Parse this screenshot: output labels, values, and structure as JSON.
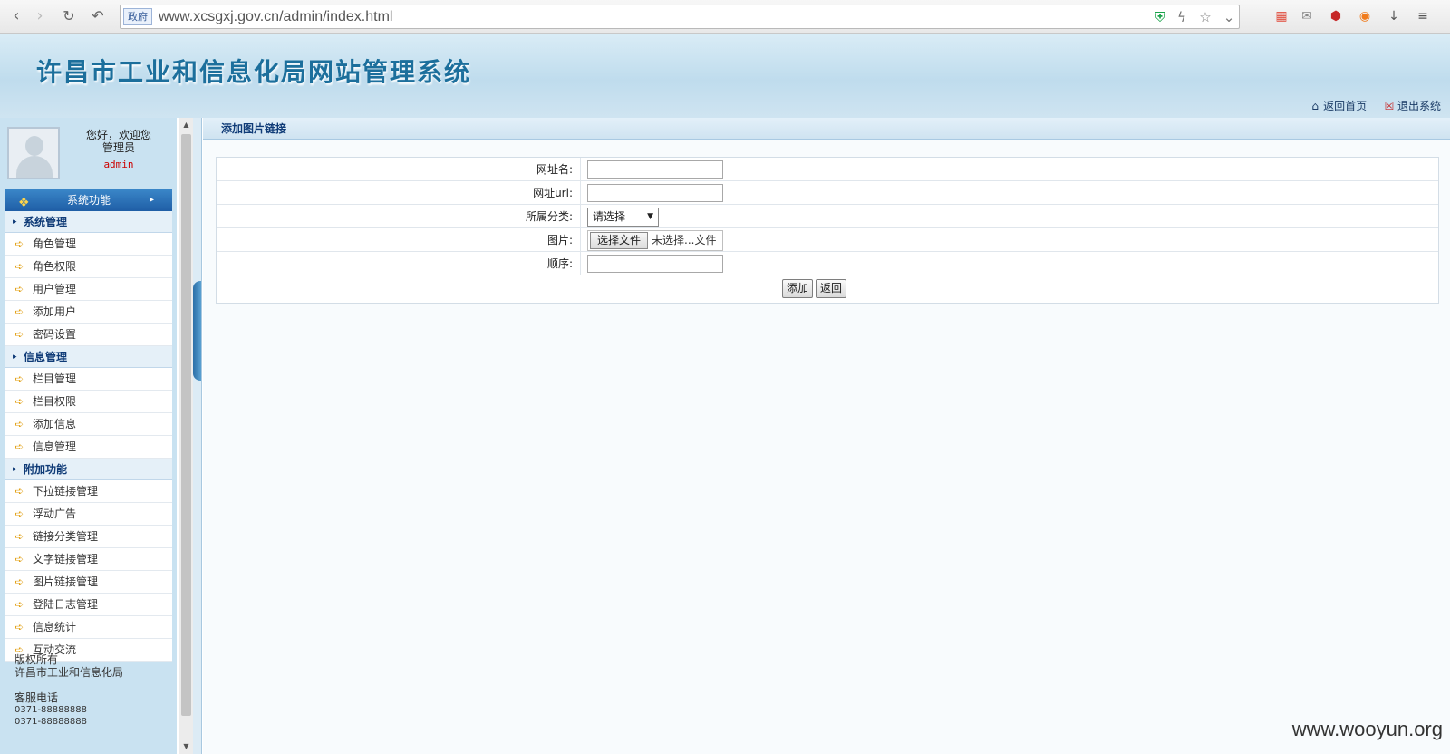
{
  "browser": {
    "gov_tag": "政府",
    "url": "www.xcsgxj.gov.cn/admin/index.html"
  },
  "site": {
    "title": "许昌市工业和信息化局网站管理系统",
    "links": {
      "home": "返回首页",
      "logout": "退出系统"
    }
  },
  "profile": {
    "greeting": "您好，欢迎您",
    "role": "管理员",
    "username": "admin"
  },
  "menu": {
    "header": "系统功能",
    "groups": [
      {
        "title": "系统管理",
        "items": [
          "角色管理",
          "角色权限",
          "用户管理",
          "添加用户",
          "密码设置"
        ]
      },
      {
        "title": "信息管理",
        "items": [
          "栏目管理",
          "栏目权限",
          "添加信息",
          "信息管理"
        ]
      },
      {
        "title": "附加功能",
        "items": [
          "下拉链接管理",
          "浮动广告",
          "链接分类管理",
          "文字链接管理",
          "图片链接管理",
          "登陆日志管理",
          "信息统计",
          "互动交流"
        ]
      }
    ]
  },
  "footer": {
    "copyright": "版权所有",
    "org": "许昌市工业和信息化局",
    "phone_label": "客服电话",
    "phone1": "0371-88888888",
    "phone2": "0371-88888888"
  },
  "form": {
    "title": "添加图片链接",
    "site_name_label": "网址名:",
    "site_url_label": "网址url:",
    "category_label": "所属分类:",
    "category_value": "请选择",
    "image_label": "图片:",
    "file_button": "选择文件",
    "file_status": "未选择...文件",
    "order_label": "顺序:",
    "add_button": "添加",
    "back_button": "返回"
  },
  "watermark": "www.wooyun.org"
}
